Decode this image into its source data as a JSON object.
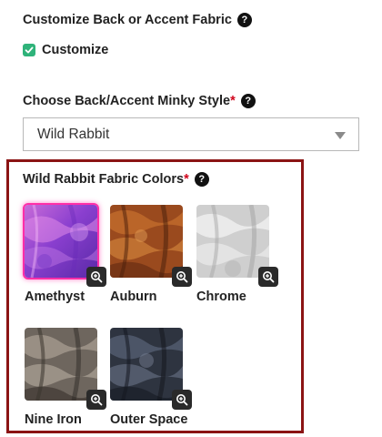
{
  "back_fabric": {
    "title": "Customize Back or Accent Fabric",
    "checkbox_label": "Customize",
    "checked": true
  },
  "minky_style": {
    "title": "Choose Back/Accent Minky Style",
    "required_mark": "*",
    "selected": "Wild Rabbit"
  },
  "fabric_colors": {
    "title": "Wild Rabbit Fabric Colors",
    "required_mark": "*",
    "selected": "Amethyst",
    "swatches": [
      {
        "name": "Amethyst"
      },
      {
        "name": "Auburn"
      },
      {
        "name": "Chrome"
      },
      {
        "name": "Nine Iron"
      },
      {
        "name": "Outer Space"
      }
    ]
  },
  "icons": {
    "help": "question-circle-icon",
    "zoom": "zoom-in-icon",
    "check": "check-icon",
    "dropdown": "caret-down-icon"
  },
  "colors": {
    "required": "#d0021b",
    "checkbox": "#2fb37a",
    "selection_frame": "#8b1414",
    "selected_swatch_glow": "#ff2fa8"
  }
}
